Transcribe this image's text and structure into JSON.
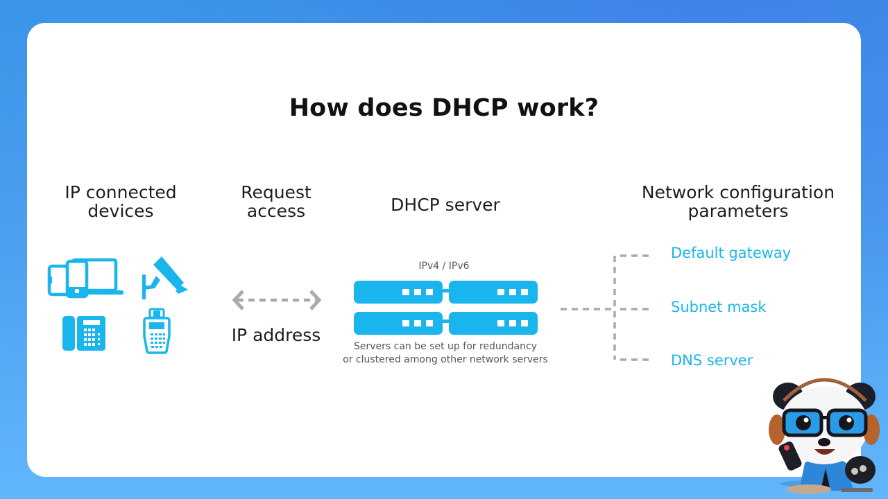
{
  "title": "How does DHCP work?",
  "columns": {
    "devices": {
      "line1": "IP connected",
      "line2": "devices"
    },
    "request": {
      "line1": "Request",
      "line2": "access"
    },
    "server": {
      "label": "DHCP server"
    },
    "params": {
      "line1": "Network configuration",
      "line2": "parameters"
    }
  },
  "devices": {
    "icons": [
      "devices-laptop-phone-tablet-icon",
      "security-camera-icon",
      "desk-phone-icon",
      "handheld-terminal-icon"
    ]
  },
  "arrow": {
    "icon": "bidirectional-dashed-arrow-icon",
    "label": "IP address"
  },
  "server": {
    "protocol_label": "IPv4 / IPv6",
    "caption_line1": "Servers can be set up for redundancy",
    "caption_line2": "or clustered among other network servers",
    "icon": "server-cluster-icon"
  },
  "parameters": [
    {
      "label": "Default gateway"
    },
    {
      "label": "Subnet mask"
    },
    {
      "label": "DNS server"
    }
  ],
  "mascot": {
    "icon": "panda-mascot-with-headphones-icon"
  },
  "colors": {
    "accent": "#19b5ec",
    "connector": "#a9aab0",
    "text": "#1e1e1e",
    "background_top": "#3a94e8",
    "background_bottom": "#62b6fc"
  }
}
